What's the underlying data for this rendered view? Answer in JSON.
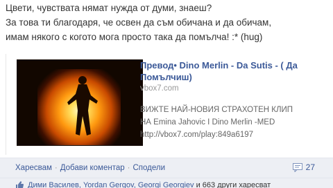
{
  "post": {
    "lines": [
      "Цвети, чувствата нямат нужда от думи, знаеш?",
      "За това ти благодаря, че освен да съм обичана и да обичам,",
      "имам някого с когото мога просто така да помълча! :* (hug)"
    ]
  },
  "link_preview": {
    "title": "Превод• Dino Merlin - Da Sutis - ( Да Помълчиш)",
    "domain": "vbox7.com",
    "description_lines": [
      "ВИЖТЕ НАЙ-НОВИЯ СТРАХОТЕН КЛИП",
      "НА Emina Jahovic I Dino Merlin -MED",
      "http://vbox7.com/play:849a6197"
    ],
    "thumbnail_icon": "video-thumbnail"
  },
  "actions": {
    "like": "Харесвам",
    "comment": "Добави коментар",
    "share": "Сподели",
    "separator": "·",
    "comment_count": "27"
  },
  "likes": {
    "names": "Дими Василев, Yordan Gergov, Georgi Georgiev",
    "others": "и 663 други харесват"
  },
  "colors": {
    "link": "#3b5998",
    "action_bar_bg": "#edeff4",
    "muted_text": "#666666"
  }
}
